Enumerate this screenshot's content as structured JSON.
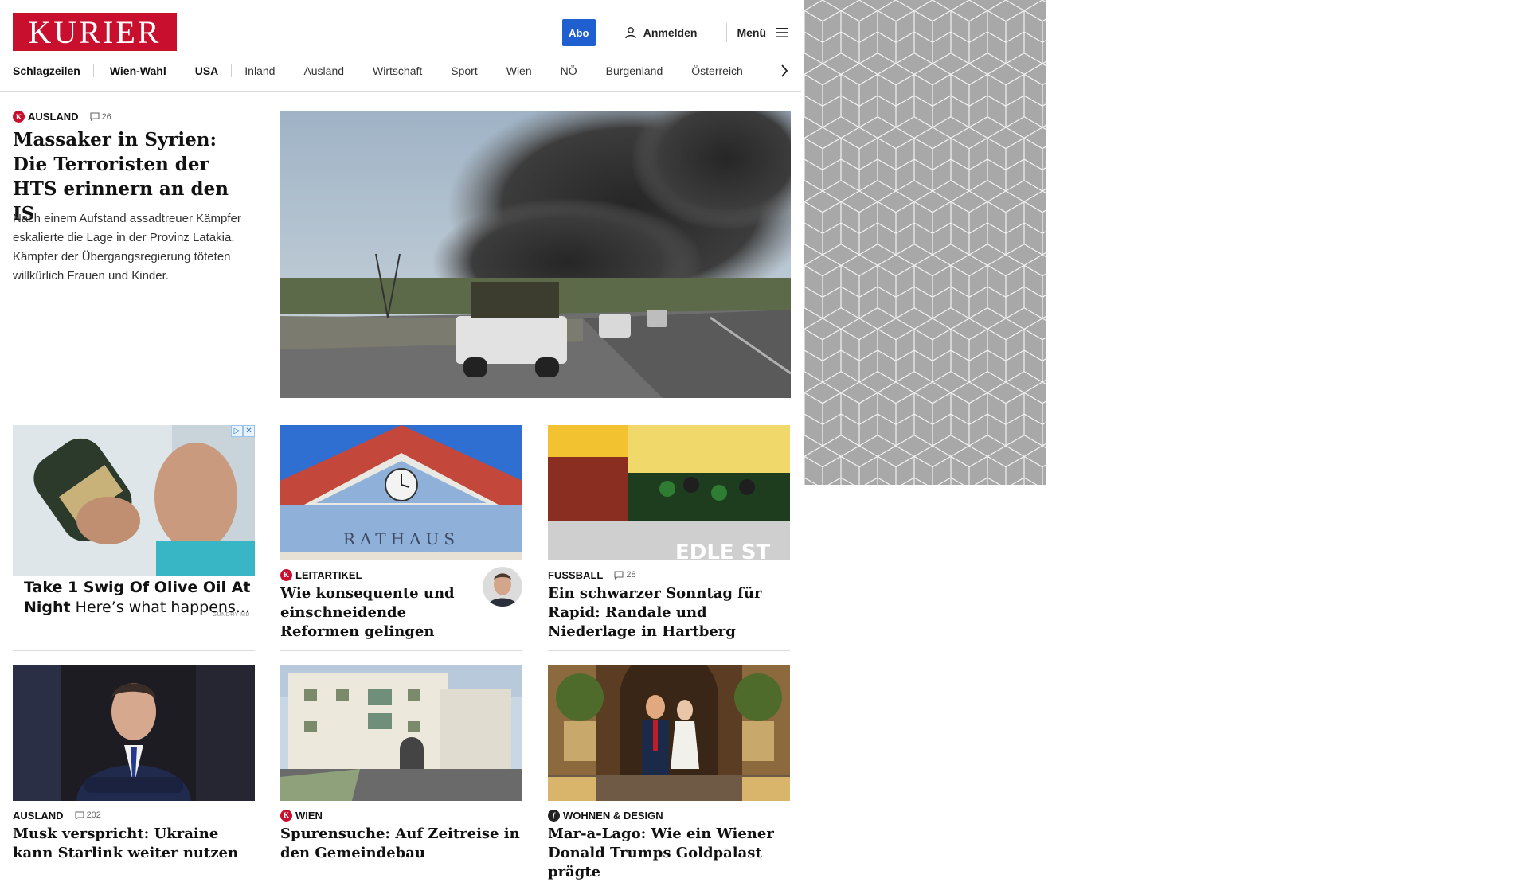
{
  "header": {
    "logo": "KURIER",
    "abo": "Abo",
    "login": "Anmelden",
    "menu": "Menü"
  },
  "nav": {
    "items": [
      "Schlagzeilen",
      "Wien-Wahl",
      "USA",
      "Inland",
      "Ausland",
      "Wirtschaft",
      "Sport",
      "Wien",
      "NÖ",
      "Burgenland",
      "Österreich"
    ]
  },
  "lead": {
    "category": "AUSLAND",
    "comments": "26",
    "title": "Massaker in Syrien: Die Terroristen der HTS erinnern an den IS",
    "teaser": "Nach einem Aufstand assadtreuer Kämpfer eskalierte die Lage in der Provinz Latakia. Kämpfer der Übergangsregierung töteten willkürlich Frauen und Kinder."
  },
  "ad": {
    "headline": "Take 1 Swig Of Olive Oil At Night",
    "text": "Here’s what happens...",
    "sponsor": "GUNDRY MD"
  },
  "cards": [
    {
      "category": "LEITARTIKEL",
      "title": "Wie konsequente und einschneidende Reformen gelingen",
      "image_text": "RATHAUS"
    },
    {
      "category": "FUSSBALL",
      "comments": "28",
      "title": "Ein schwarzer Sonntag für Rapid: Randale und Niederlage in Hartberg",
      "image_text": "EDLE ST"
    },
    {
      "category": "AUSLAND",
      "comments": "202",
      "title": "Musk verspricht: Ukraine kann Starlink weiter nutzen"
    },
    {
      "category": "WIEN",
      "title": "Spurensuche: Auf Zeitreise in den Gemeindebau"
    },
    {
      "category": "WOHNEN & DESIGN",
      "title": "Mar-a-Lago: Wie ein Wiener Donald Trumps Goldpalast prägte"
    }
  ],
  "colors": {
    "brand_red": "#c8102e",
    "abo_blue": "#1f5fd0"
  }
}
